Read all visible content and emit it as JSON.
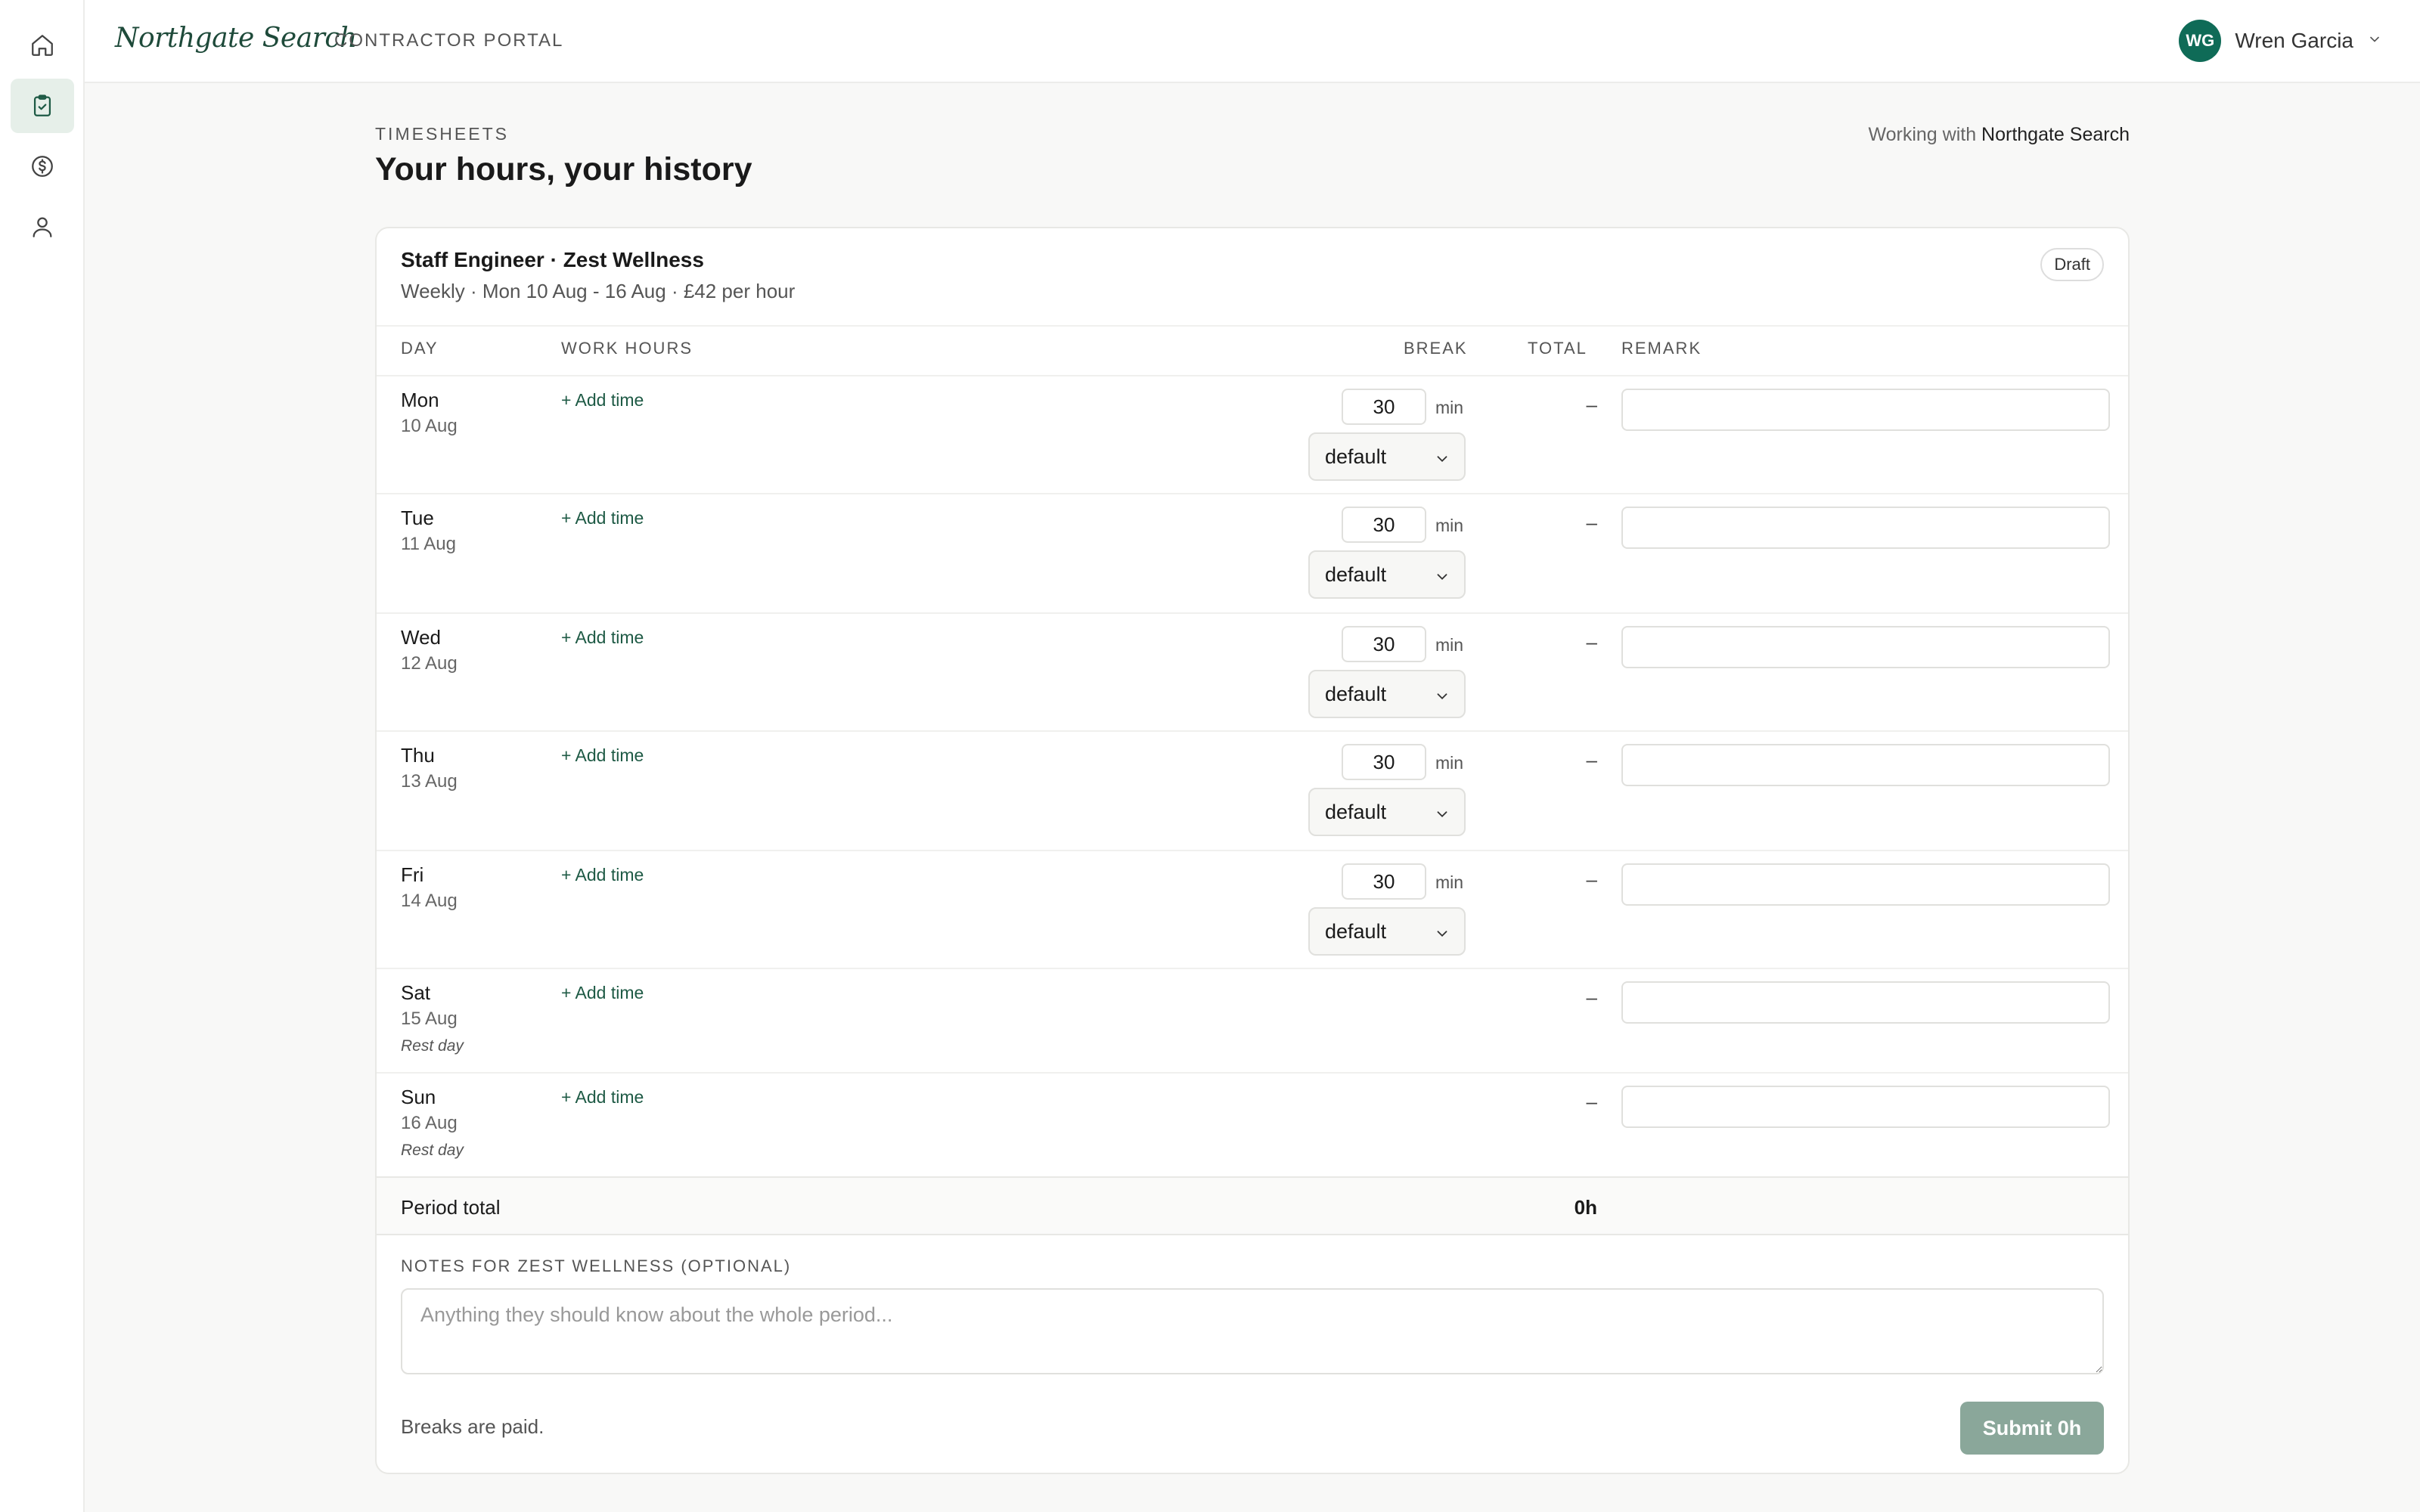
{
  "app": {
    "brand": "Northgate Search",
    "portal_label": "CONTRACTOR PORTAL",
    "user": {
      "initials": "WG",
      "name": "Wren Garcia"
    }
  },
  "sidebar": {
    "items": [
      {
        "icon": "home-icon",
        "active": false
      },
      {
        "icon": "clipboard-check-icon",
        "active": true
      },
      {
        "icon": "dollar-icon",
        "active": false
      },
      {
        "icon": "user-icon",
        "active": false
      }
    ]
  },
  "page": {
    "eyebrow": "TIMESHEETS",
    "title": "Your hours, your history",
    "working_with_prefix": "Working with",
    "working_with_company": "Northgate Search"
  },
  "card": {
    "job_title": "Staff Engineer · Zest Wellness",
    "meta": "Weekly · Mon 10 Aug - 16 Aug · £42 per hour",
    "status": "Draft",
    "columns": {
      "day": "DAY",
      "work_hours": "WORK HOURS",
      "break": "BREAK",
      "total": "TOTAL",
      "remark": "REMARK"
    },
    "add_time_label": "+ Add time",
    "min_label": "min",
    "rows": [
      {
        "day": "Mon",
        "date": "10 Aug",
        "break": "30",
        "mode": "default",
        "total": "–",
        "rest": ""
      },
      {
        "day": "Tue",
        "date": "11 Aug",
        "break": "30",
        "mode": "default",
        "total": "–",
        "rest": ""
      },
      {
        "day": "Wed",
        "date": "12 Aug",
        "break": "30",
        "mode": "default",
        "total": "–",
        "rest": ""
      },
      {
        "day": "Thu",
        "date": "13 Aug",
        "break": "30",
        "mode": "default",
        "total": "–",
        "rest": ""
      },
      {
        "day": "Fri",
        "date": "14 Aug",
        "break": "30",
        "mode": "default",
        "total": "–",
        "rest": ""
      },
      {
        "day": "Sat",
        "date": "15 Aug",
        "break": "",
        "mode": "",
        "total": "–",
        "rest": "Rest day"
      },
      {
        "day": "Sun",
        "date": "16 Aug",
        "break": "",
        "mode": "",
        "total": "–",
        "rest": "Rest day"
      }
    ],
    "period_total_label": "Period total",
    "period_total": "0h",
    "notes_label": "NOTES FOR ZEST WELLNESS (OPTIONAL)",
    "notes_placeholder": "Anything they should know about the whole period...",
    "footnote": "Breaks are paid.",
    "submit_label": "Submit 0h"
  },
  "colors": {
    "accent": "#0f6b57",
    "brand_text": "#1e4a3a",
    "submit_disabled": "#8aa79a"
  }
}
